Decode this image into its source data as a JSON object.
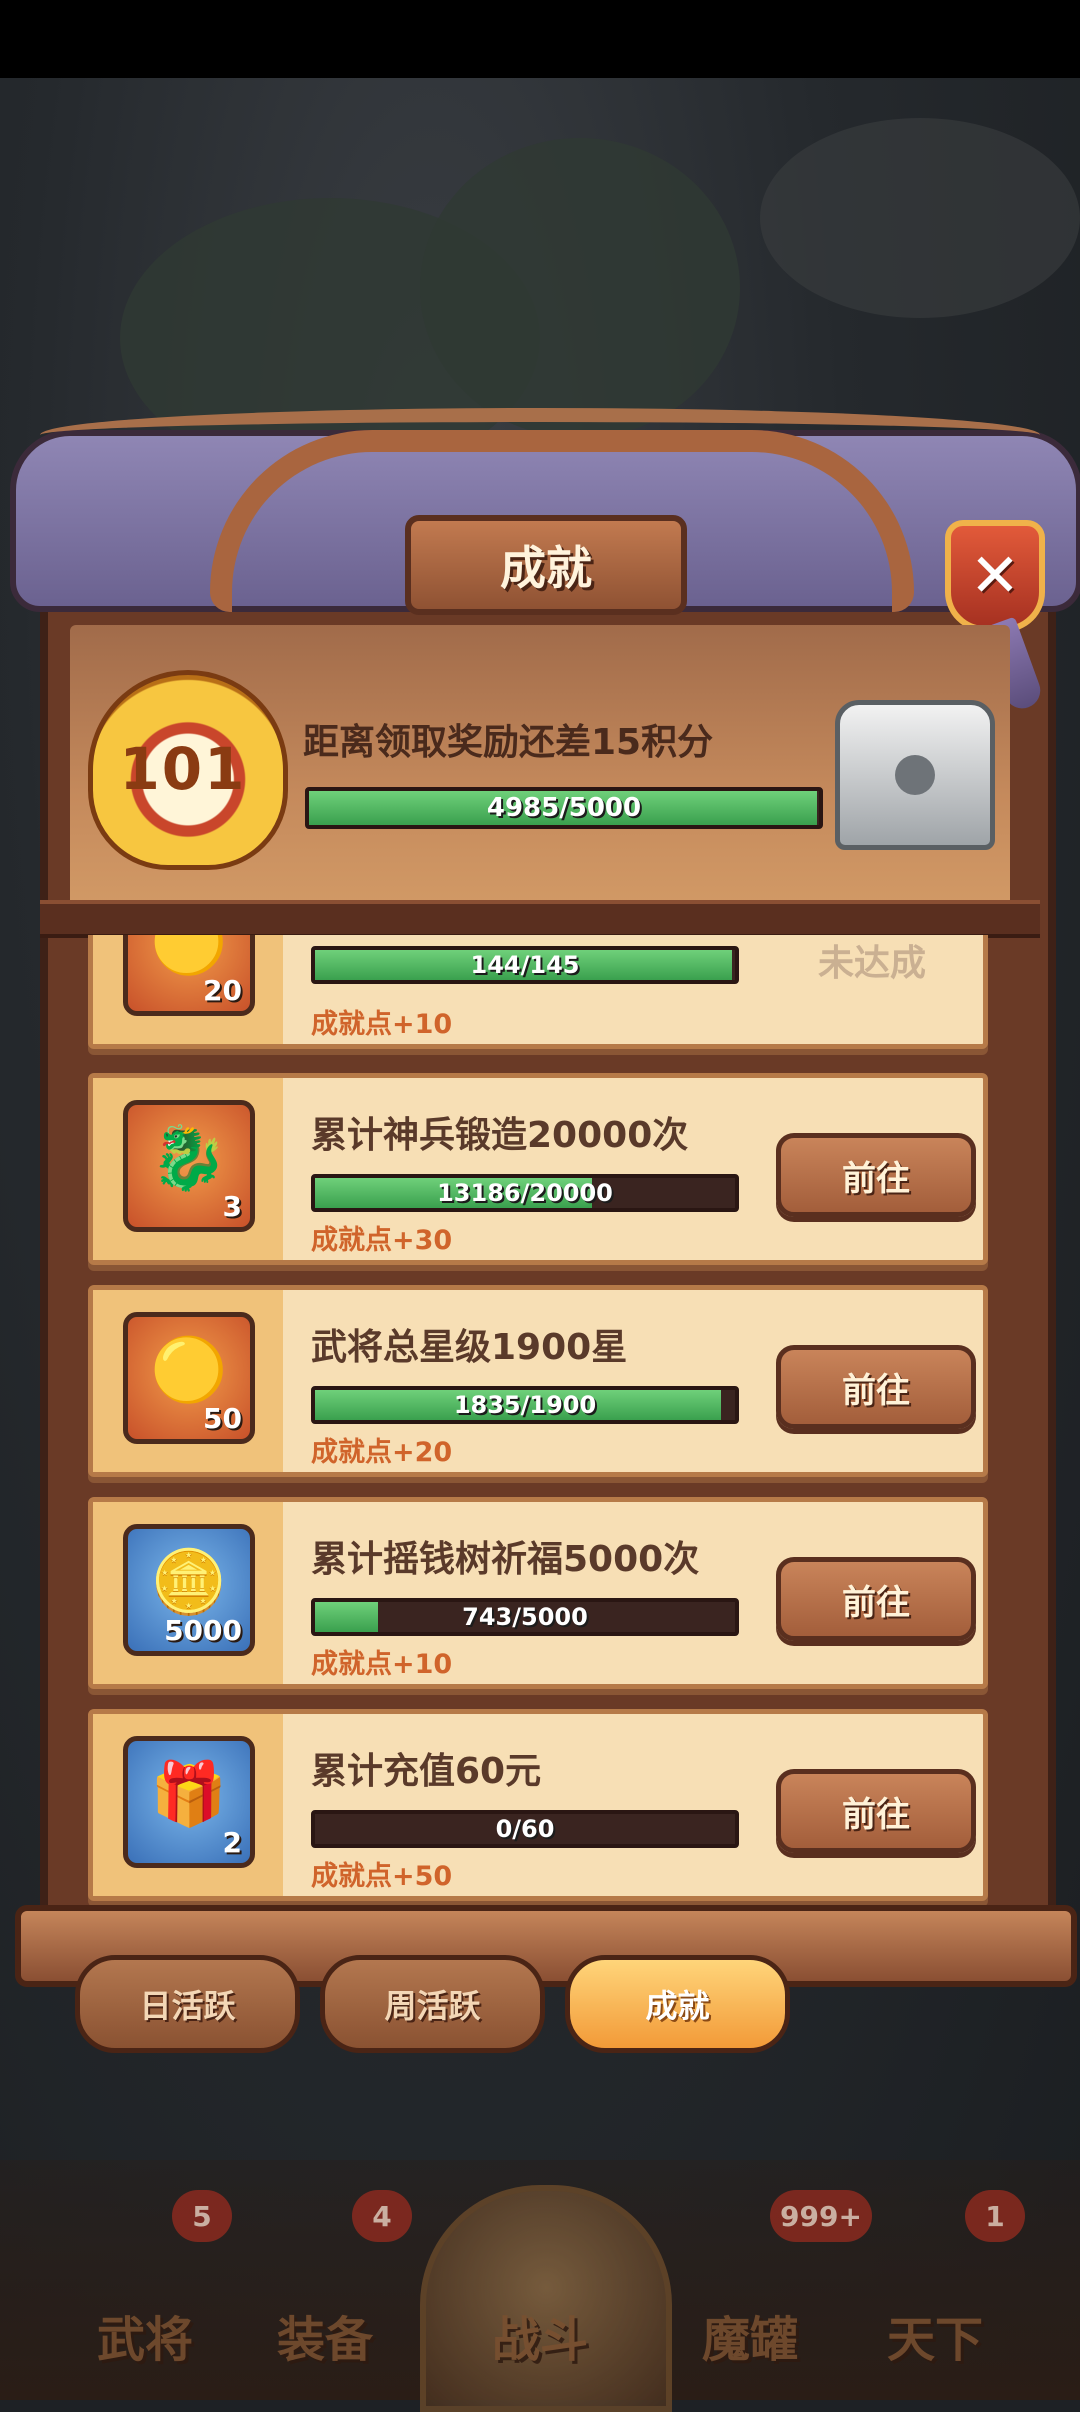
{
  "window": {
    "title": "成就"
  },
  "header": {
    "level": "101",
    "reward_message": "距离领取奖励还差15积分",
    "progress": {
      "text": "4985/5000",
      "fraction": 0.997
    }
  },
  "achievements": [
    {
      "title": "",
      "icon": "gold-ingot-icon",
      "qty": "20",
      "progress_text": "144/145",
      "fraction": 0.993,
      "points": "成就点+10",
      "status": "未达成",
      "color": "orange"
    },
    {
      "title": "累计神兵锻造20000次",
      "icon": "dragon-icon",
      "qty": "3",
      "progress_text": "13186/20000",
      "fraction": 0.659,
      "points": "成就点+30",
      "button": "前往",
      "color": "orange"
    },
    {
      "title": "武将总星级1900星",
      "icon": "gold-ingot-icon",
      "qty": "50",
      "progress_text": "1835/1900",
      "fraction": 0.966,
      "points": "成就点+20",
      "button": "前往",
      "color": "orange"
    },
    {
      "title": "累计摇钱树祈福5000次",
      "icon": "coin-icon",
      "qty": "5000",
      "progress_text": "743/5000",
      "fraction": 0.149,
      "points": "成就点+10",
      "button": "前往",
      "color": "blue"
    },
    {
      "title": "累计充值60元",
      "icon": "treasure-box-icon",
      "qty": "2",
      "progress_text": "0/60",
      "fraction": 0.0,
      "points": "成就点+50",
      "button": "前往",
      "color": "blue"
    }
  ],
  "tabs": [
    {
      "label": "日活跃"
    },
    {
      "label": "周活跃"
    },
    {
      "label": "成就",
      "active": true
    }
  ],
  "bottom_nav": [
    {
      "label": "武将",
      "badge": "5"
    },
    {
      "label": "装备",
      "badge": "4"
    },
    {
      "label": "战斗"
    },
    {
      "label": "魔罐",
      "badge": "999+"
    },
    {
      "label": "天下",
      "badge": "1"
    }
  ]
}
